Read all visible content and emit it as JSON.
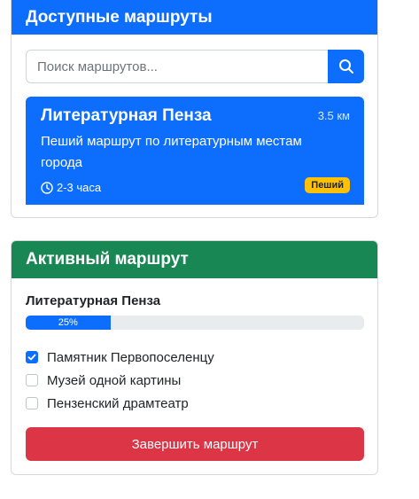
{
  "available": {
    "title": "Доступные маршруты",
    "search": {
      "placeholder": "Поиск маршрутов...",
      "value": ""
    },
    "routes": [
      {
        "title": "Литературная Пенза",
        "distance": "3.5 км",
        "description": "Пеший маршрут по литературным местам города",
        "duration": "2-3 часа",
        "badge": "Пеший"
      }
    ]
  },
  "active": {
    "title": "Активный маршрут",
    "route_name": "Литературная Пенза",
    "progress": 25,
    "progress_label": "25%",
    "points": [
      {
        "label": "Памятник Первопоселенцу",
        "checked": true
      },
      {
        "label": "Музей одной картины",
        "checked": false
      },
      {
        "label": "Пензенский драмтеатр",
        "checked": false
      }
    ],
    "finish_label": "Завершить маршрут"
  },
  "colors": {
    "primary": "#0d6efd",
    "success": "#198754",
    "danger": "#dc3545",
    "warning": "#ffc107"
  }
}
